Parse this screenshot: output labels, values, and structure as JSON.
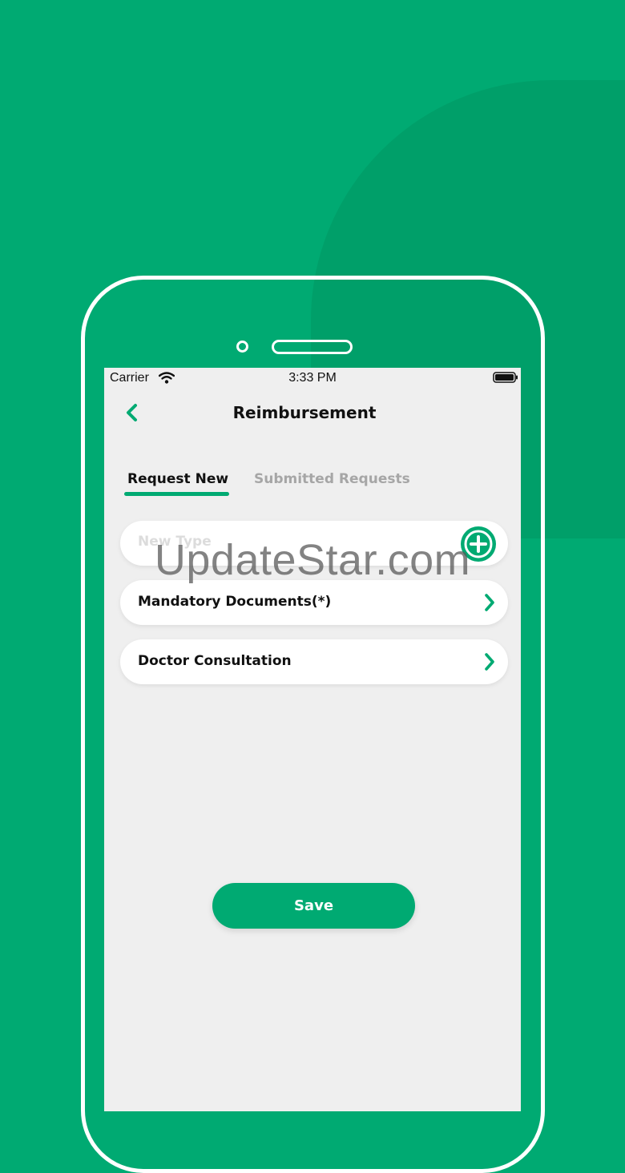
{
  "status_bar": {
    "carrier": "Carrier",
    "time": "3:33 PM"
  },
  "header": {
    "title": "Reimbursement"
  },
  "tabs": [
    {
      "label": "Request New",
      "active": true
    },
    {
      "label": "Submitted Requests",
      "active": false
    }
  ],
  "new_type": {
    "placeholder": "New Type",
    "value": ""
  },
  "list_items": [
    {
      "label": "Mandatory Documents(*)"
    },
    {
      "label": "Doctor Consultation"
    }
  ],
  "actions": {
    "save_label": "Save"
  },
  "watermark": "UpdateStar.com",
  "colors": {
    "accent": "#00aa72",
    "background_blob": "#009f69",
    "screen_bg": "#efefef",
    "inactive_tab": "#a6a6a6"
  },
  "icons": {
    "back": "chevron-left-icon",
    "add": "plus-circle-icon",
    "row": "chevron-right-icon",
    "wifi": "wifi-icon",
    "battery": "battery-icon"
  }
}
